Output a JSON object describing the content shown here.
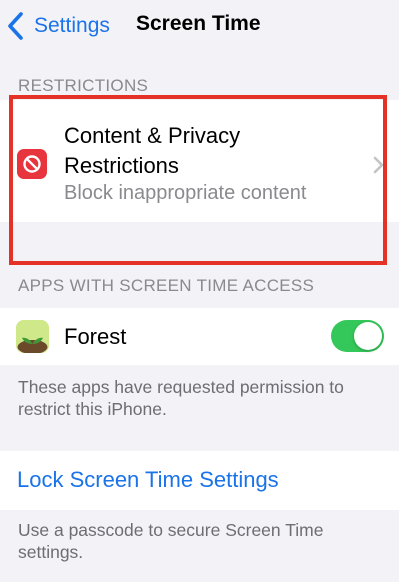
{
  "navbar": {
    "back_label": "Settings",
    "title": "Screen Time"
  },
  "restrictions": {
    "header": "RESTRICTIONS",
    "item": {
      "title": "Content & Privacy Restrictions",
      "subtitle": "Block inappropriate content",
      "icon": "no-entry-icon",
      "icon_color": "#e8343c"
    }
  },
  "apps_access": {
    "header": "APPS WITH SCREEN TIME ACCESS",
    "apps": [
      {
        "name": "Forest",
        "icon": "forest-app-icon",
        "enabled": true
      }
    ],
    "footer": "These apps have requested permission to restrict this iPhone."
  },
  "lock": {
    "label": "Lock Screen Time Settings",
    "footer": "Use a passcode to secure Screen Time settings."
  },
  "colors": {
    "accent": "#1a73e8",
    "toggle_on": "#34c759",
    "highlight": "#e53227",
    "background": "#f2f2f7"
  }
}
